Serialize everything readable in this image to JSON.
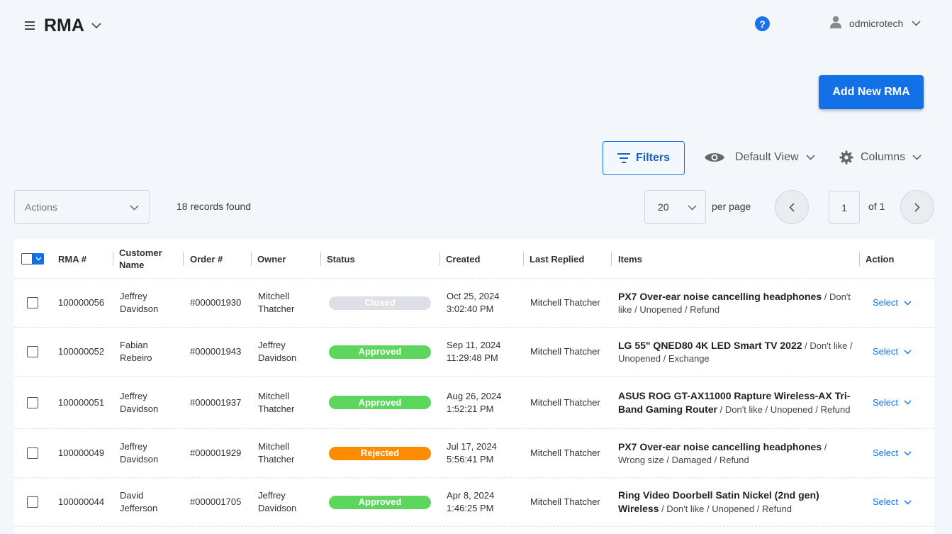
{
  "header": {
    "title": "RMA",
    "user_name": "odmicrotech",
    "help_label": "?"
  },
  "toolbar": {
    "add_button": "Add New RMA",
    "filters_button": "Filters",
    "view_label": "Default View",
    "columns_label": "Columns"
  },
  "controls": {
    "actions_placeholder": "Actions",
    "records_found": "18 records found",
    "per_page_value": "20",
    "per_page_label": "per page",
    "current_page": "1",
    "total_pages_label": "of 1"
  },
  "table": {
    "columns": [
      "RMA #",
      "Customer Name",
      "Order #",
      "Owner",
      "Status",
      "Created",
      "Last Replied",
      "Items",
      "Action"
    ],
    "rows": [
      {
        "rma": "100000056",
        "customer": "Jeffrey Davidson",
        "order": "#000001930",
        "owner": "Mitchell Thatcher",
        "status": "Closed",
        "created_date": "Oct 25, 2024",
        "created_time": "3:02:40 PM",
        "last_replied": "Mitchell Thatcher",
        "item_name": "PX7 Over-ear noise cancelling headphones",
        "item_detail": " / Don't like / Unopened / Refund",
        "action": "Select"
      },
      {
        "rma": "100000052",
        "customer": "Fabian Rebeiro",
        "order": "#000001943",
        "owner": "Jeffrey Davidson",
        "status": "Approved",
        "created_date": "Sep 11, 2024",
        "created_time": "11:29:48 PM",
        "last_replied": "Mitchell Thatcher",
        "item_name": "LG 55\" QNED80 4K LED Smart TV 2022",
        "item_detail": " / Don't like / Unopened / Exchange",
        "action": "Select"
      },
      {
        "rma": "100000051",
        "customer": "Jeffrey Davidson",
        "order": "#000001937",
        "owner": "Mitchell Thatcher",
        "status": "Approved",
        "created_date": "Aug 26, 2024",
        "created_time": "1:52:21 PM",
        "last_replied": "Mitchell Thatcher",
        "item_name": "ASUS ROG GT-AX11000 Rapture Wireless-AX Tri-Band Gaming Router",
        "item_detail": " / Don't like / Unopened / Refund",
        "action": "Select"
      },
      {
        "rma": "100000049",
        "customer": "Jeffrey Davidson",
        "order": "#000001929",
        "owner": "Mitchell Thatcher",
        "status": "Rejected",
        "created_date": "Jul 17, 2024",
        "created_time": "5:56:41 PM",
        "last_replied": "Mitchell Thatcher",
        "item_name": "PX7 Over-ear noise cancelling headphones",
        "item_detail": " / Wrong size / Damaged / Refund",
        "action": "Select"
      },
      {
        "rma": "100000044",
        "customer": "David Jefferson",
        "order": "#000001705",
        "owner": "Jeffrey Davidson",
        "status": "Approved",
        "created_date": "Apr 8, 2024",
        "created_time": "1:46:25 PM",
        "last_replied": "Mitchell Thatcher",
        "item_name": "Ring Video Doorbell Satin Nickel (2nd gen) Wireless",
        "item_detail": " / Don't like / Unopened / Refund",
        "action": "Select"
      }
    ]
  },
  "colors": {
    "accent": "#1271e6",
    "status_closed": "#dcdfe3",
    "status_approved": "#5cd65c",
    "status_rejected": "#ff8c00"
  },
  "icons": {
    "menu": "hamburger-icon",
    "help": "help-circle-icon",
    "user": "user-icon",
    "filter": "filter-icon",
    "view": "eye-icon",
    "columns": "gear-icon",
    "dropdown": "chevron-down-icon",
    "prev": "chevron-left-icon",
    "next": "chevron-right-icon"
  }
}
